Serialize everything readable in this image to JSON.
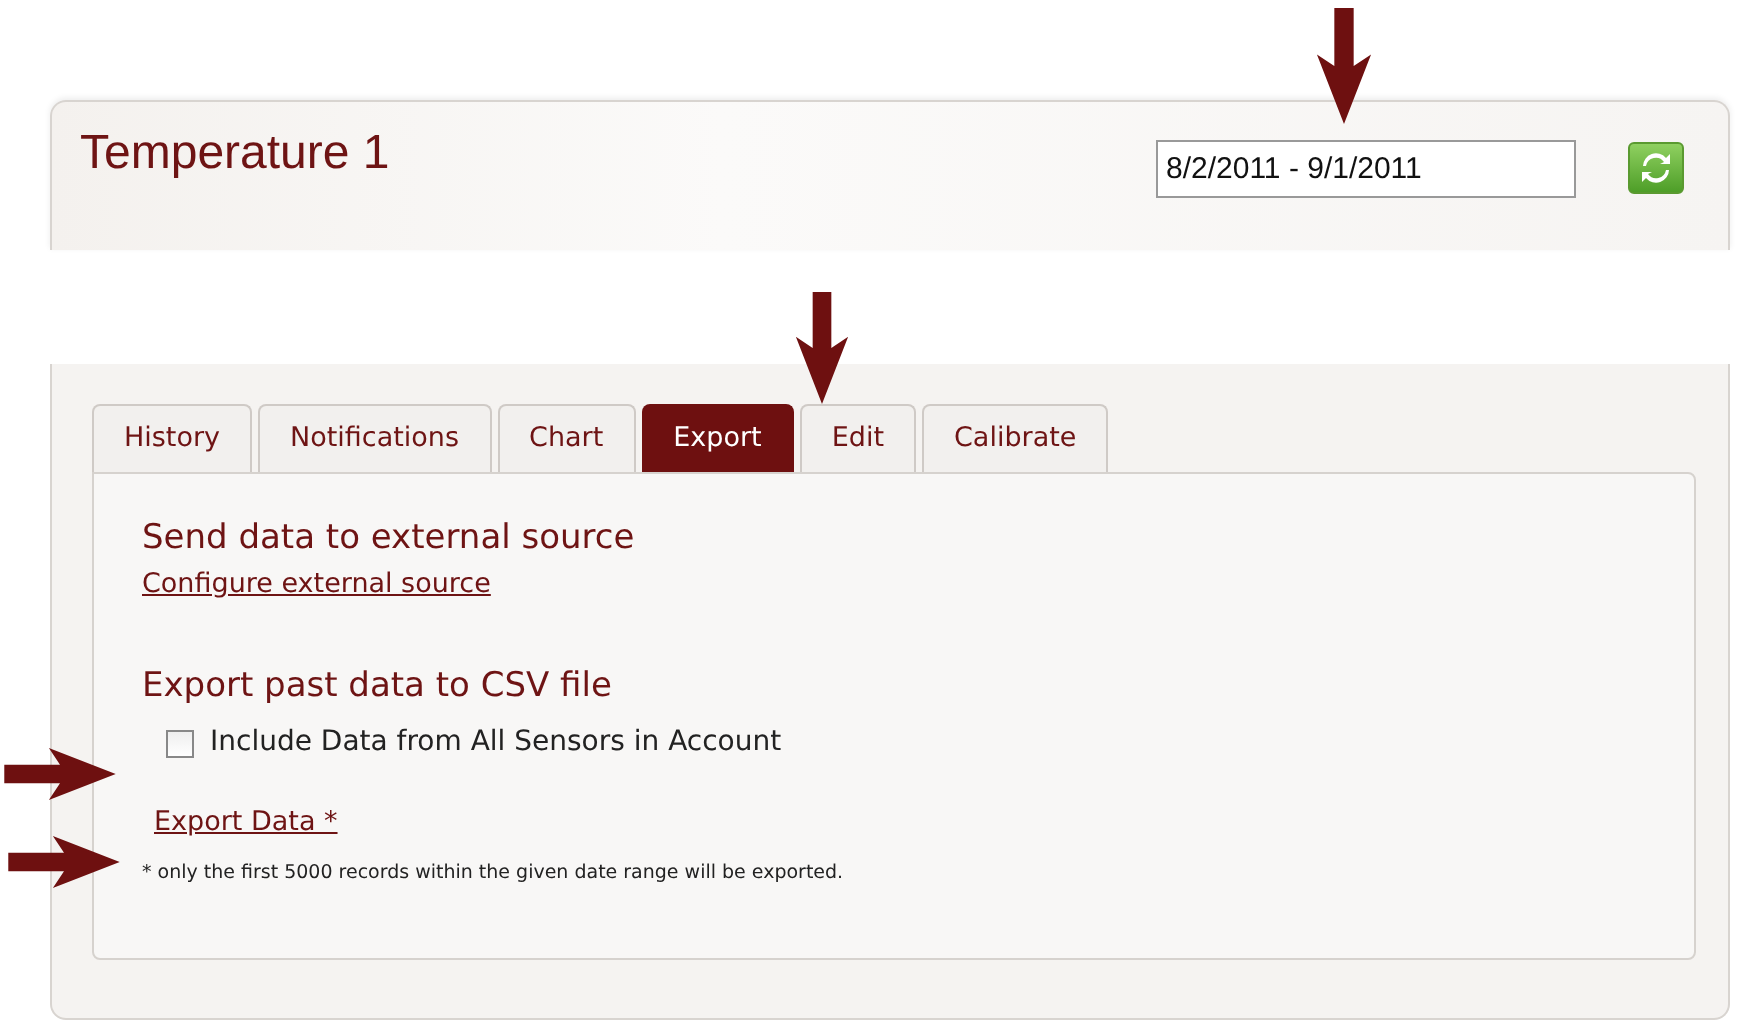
{
  "header": {
    "title": "Temperature 1",
    "date_range": "8/2/2011 - 9/1/2011"
  },
  "tabs": [
    {
      "label": "History",
      "selected": false
    },
    {
      "label": "Notifications",
      "selected": false
    },
    {
      "label": "Chart",
      "selected": false
    },
    {
      "label": "Export",
      "selected": true
    },
    {
      "label": "Edit",
      "selected": false
    },
    {
      "label": "Calibrate",
      "selected": false
    }
  ],
  "external": {
    "heading": "Send data to external source",
    "link": "Configure external source"
  },
  "csv": {
    "heading": "Export past data to CSV file",
    "checkbox": {
      "label": "Include Data from All Sensors in Account",
      "checked": false
    },
    "link": "Export Data *",
    "note": "* only the first 5000 records within the given date range will be exported."
  }
}
